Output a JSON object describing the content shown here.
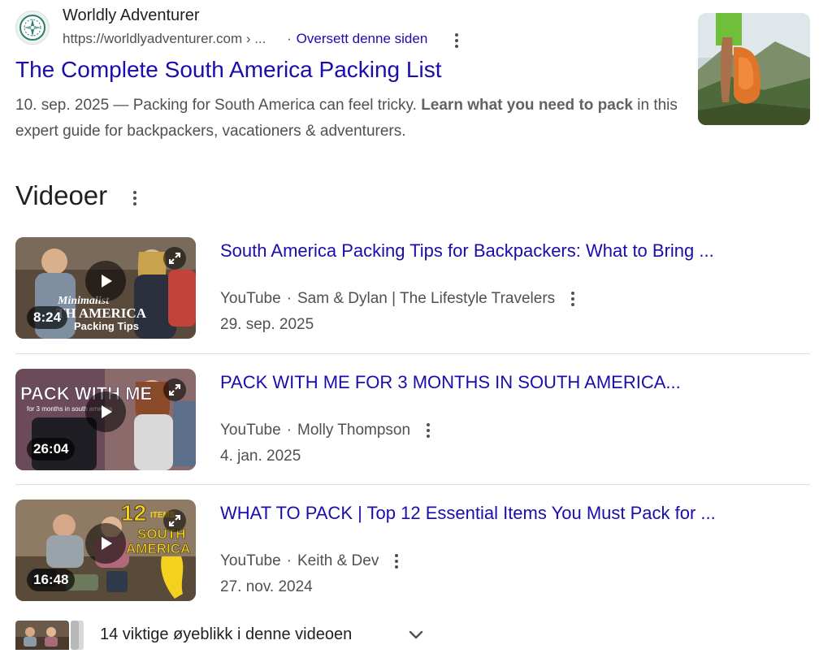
{
  "result": {
    "site_name": "Worldly Adventurer",
    "url": "https://worldlyadventurer.com › ...",
    "translate_separator": "·",
    "translate_label": "Oversett denne siden",
    "title": "The Complete South America Packing List",
    "snippet": {
      "date": "10. sep. 2025",
      "dash": " — ",
      "text1": "Packing for South America can feel tricky. ",
      "bold": "Learn what you need to pack",
      "text2": " in this expert guide for backpackers, vacationers & adventurers."
    }
  },
  "videos_section": {
    "heading": "Videoer",
    "items": [
      {
        "title": "South America Packing Tips for Backpackers: What to Bring ...",
        "source": "YouTube",
        "separator": "·",
        "channel": "Sam & Dylan | The Lifestyle Travelers",
        "date": "29. sep. 2025",
        "duration": "8:24",
        "thumb_line1": "Minimalist",
        "thumb_line2": "TH AMERICA",
        "thumb_line3": "Packing Tips"
      },
      {
        "title": "PACK WITH ME FOR 3 MONTHS IN SOUTH AMERICA...",
        "source": "YouTube",
        "separator": "·",
        "channel": "Molly Thompson",
        "date": "4. jan. 2025",
        "duration": "26:04",
        "thumb_line1": "PACK WITH ME",
        "thumb_line2": "for 3 months in south america"
      },
      {
        "title": "WHAT TO PACK | Top 12 Essential Items You Must Pack for ...",
        "source": "YouTube",
        "separator": "·",
        "channel": "Keith & Dev",
        "date": "27. nov. 2024",
        "duration": "16:48",
        "thumb_line1": "12",
        "thumb_line2": "ITEMS",
        "thumb_line3": "SOUTH",
        "thumb_line4": "AMERICA"
      }
    ]
  },
  "key_moments": {
    "label": "14 viktige øyeblikk i denne videoen"
  },
  "icons": {
    "favicon": "compass-logo-icon",
    "more": "more-vert-icon",
    "play": "play-icon",
    "expand": "expand-icon",
    "chevron": "chevron-down-icon"
  },
  "colors": {
    "link": "#1a0dab",
    "text": "#202124",
    "muted": "#4d5156"
  }
}
